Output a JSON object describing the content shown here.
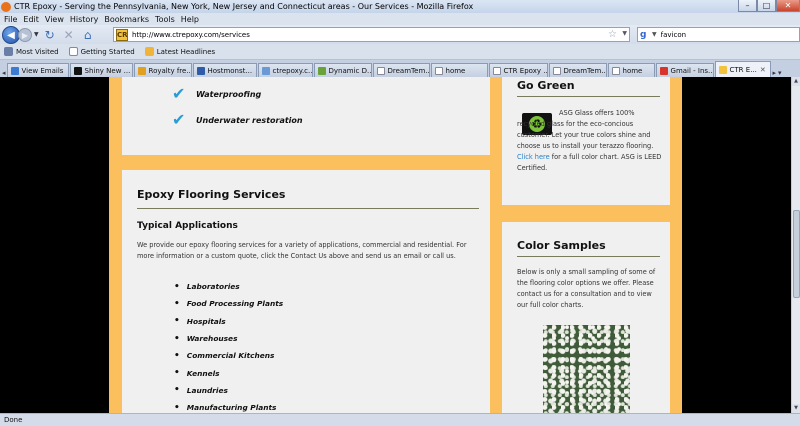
{
  "window": {
    "title": "CTR Epoxy - Serving the Pennsylvania, New York, New Jersey and Connecticut areas - Our Services - Mozilla Firefox",
    "min": "–",
    "max": "□",
    "close": "✕"
  },
  "menu": [
    "File",
    "Edit",
    "View",
    "History",
    "Bookmarks",
    "Tools",
    "Help"
  ],
  "nav": {
    "url": "http://www.ctrepoxy.com/services",
    "site_icon": "CR",
    "search_engine_icon": "google-icon",
    "search_value": "favicon"
  },
  "bookmarks": [
    {
      "label": "Most Visited",
      "icon": "gear-icon",
      "color": "#6a7fa8"
    },
    {
      "label": "Getting Started",
      "icon": "page-icon",
      "color": "#ffffff"
    },
    {
      "label": "Latest Headlines",
      "icon": "rss-icon",
      "color": "#f0b43a"
    }
  ],
  "tabs": [
    {
      "label": "View Emails",
      "color": "#3b7bd3"
    },
    {
      "label": "Shiny New ...",
      "color": "#111111"
    },
    {
      "label": "Royalty fre...",
      "color": "#e0a020"
    },
    {
      "label": "Hostmonst...",
      "color": "#2f5ca8"
    },
    {
      "label": "ctrepoxy.c...",
      "color": "#6a9ad4"
    },
    {
      "label": "Dynamic D...",
      "color": "#6aa23a"
    },
    {
      "label": "DreamTem...",
      "color": "#ffffff"
    },
    {
      "label": "home",
      "color": "#ffffff"
    },
    {
      "label": "CTR Epoxy ...",
      "color": "#ffffff"
    },
    {
      "label": "DreamTem...",
      "color": "#ffffff"
    },
    {
      "label": "home",
      "color": "#ffffff"
    },
    {
      "label": "Gmail - Ins...",
      "color": "#d9342b"
    },
    {
      "label": "CTR E...",
      "color": "#f2c33c",
      "active": true
    }
  ],
  "services_top": {
    "items": [
      "Waterproofing",
      "Underwater restoration"
    ]
  },
  "epoxy": {
    "heading": "Epoxy Flooring Services",
    "subheading": "Typical Applications",
    "intro": "We provide our epoxy flooring services for a variety of applications, commercial and residential. For more information or a custom quote, click the Contact Us above and send us an email or call us.",
    "applications": [
      "Laboratories",
      "Food Processing Plants",
      "Hospitals",
      "Warehouses",
      "Commercial Kitchens",
      "Kennels",
      "Laundries",
      "Manufacturing Plants"
    ]
  },
  "go_green": {
    "heading": "Go Green",
    "text_before": "ASG Glass offers 100% recycled glass for the eco-concious customer. Let your true colors shine and choose us to install your terazzo flooring.",
    "link": "Click here",
    "text_after": "for a full color chart. ASG is LEED Certified."
  },
  "color_samples": {
    "heading": "Color Samples",
    "text": "Below is only a small sampling of some of the flooring color options we offer. Please contact us for a consultation and to view our full color charts."
  },
  "status": "Done"
}
